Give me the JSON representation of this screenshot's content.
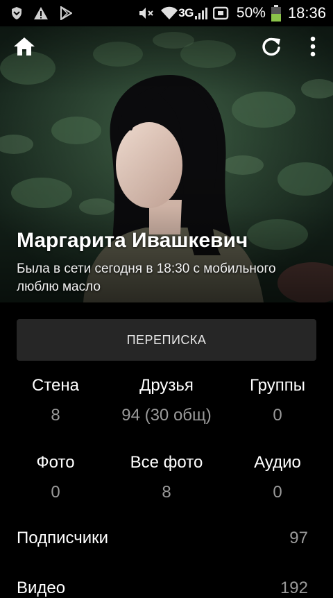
{
  "status_bar": {
    "network": "3G",
    "battery_percent": "50%",
    "time": "18:36",
    "icons": [
      "shield-icon",
      "warning-icon",
      "play-store-icon",
      "mute-icon",
      "wifi-icon",
      "signal-icon",
      "notification-icon",
      "battery-icon"
    ]
  },
  "toolbar": {
    "home_icon": "home-icon",
    "refresh_icon": "refresh-icon",
    "menu_icon": "more-vert-icon"
  },
  "profile": {
    "name": "Маргарита Ивашкевич",
    "status_line1": "Была в сети сегодня в 18:30 с мобильного",
    "status_line2": "люблю масло"
  },
  "actions": {
    "message_label": "ПЕРЕПИСКА"
  },
  "stats_row1": [
    {
      "label": "Стена",
      "value": "8"
    },
    {
      "label": "Друзья",
      "value": "94 (30 общ)"
    },
    {
      "label": "Группы",
      "value": "0"
    }
  ],
  "stats_row2": [
    {
      "label": "Фото",
      "value": "0"
    },
    {
      "label": "Все фото",
      "value": "8"
    },
    {
      "label": "Аудио",
      "value": "0"
    }
  ],
  "list": [
    {
      "label": "Подписчики",
      "value": "97"
    },
    {
      "label": "Видео",
      "value": "192"
    }
  ],
  "colors": {
    "background": "#000000",
    "button_bg": "#262626",
    "secondary_text": "#9a9a9a"
  }
}
